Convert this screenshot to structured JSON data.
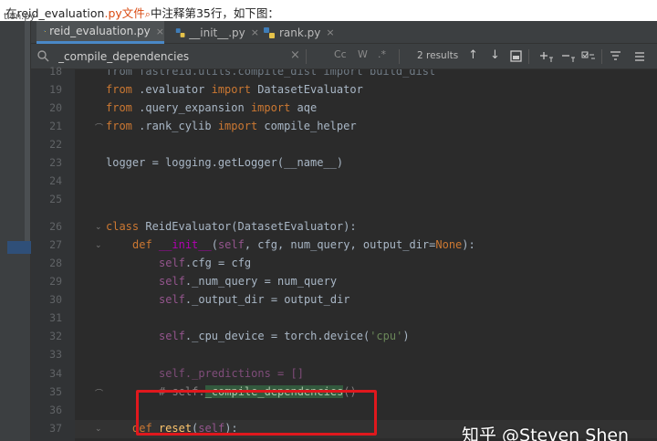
{
  "article": {
    "prefix": "在reid_evaluation",
    "highlight": ".py文件",
    "search_glyph": "⌕",
    "suffix": "中注释第35行，如下图：",
    "clipped": "tion.py"
  },
  "tabs": [
    {
      "label": "reid_evaluation.py",
      "close": "×",
      "active": true
    },
    {
      "label": "__init__.py",
      "close": "×",
      "active": false
    },
    {
      "label": "rank.py",
      "close": "×",
      "active": false
    }
  ],
  "search": {
    "value": "_compile_dependencies",
    "clear": "×",
    "cc": "Cc",
    "w": "W",
    "regex": ".*",
    "results": "2 results",
    "up": "↑",
    "down": "↓"
  },
  "lines": [
    {
      "num": "18"
    },
    {
      "num": "19"
    },
    {
      "num": "20"
    },
    {
      "num": "21"
    },
    {
      "num": "22"
    },
    {
      "num": "23"
    },
    {
      "num": "24"
    },
    {
      "num": "25"
    },
    {
      "num": "26"
    },
    {
      "num": "27"
    },
    {
      "num": "28"
    },
    {
      "num": "29"
    },
    {
      "num": "30"
    },
    {
      "num": "31"
    },
    {
      "num": "32"
    },
    {
      "num": "33"
    },
    {
      "num": "34"
    },
    {
      "num": "35"
    },
    {
      "num": "36"
    },
    {
      "num": "37"
    }
  ],
  "code": {
    "l18": "from fastreid.utils.compile_dist import build_dist",
    "l19_from": "from",
    "l19_mod": " .evaluator ",
    "l19_imp": "import",
    "l19_name": " DatasetEvaluator",
    "l20_from": "from",
    "l20_mod": " .query_expansion ",
    "l20_imp": "import",
    "l20_name": " aqe",
    "l21_from": "from",
    "l21_mod": " .rank_cylib ",
    "l21_imp": "import",
    "l21_name": " compile_helper",
    "l23": "logger = logging.getLogger(__name__)",
    "l26_class": "class",
    "l26_rest": " ReidEvaluator(DatasetEvaluator):",
    "l27_def": "def",
    "l27_init": "__init__",
    "l27_self": "self",
    "l27_args": ", cfg, num_query, output_dir=",
    "l27_none": "None",
    "l27_end": "):",
    "l28_self": "self",
    "l28_rest": ".cfg = cfg",
    "l29_self": "self",
    "l29_rest": "._num_query = num_query",
    "l30_self": "self",
    "l30_rest": "._output_dir = output_dir",
    "l32_self": "self",
    "l32_rest": "._cpu_device = torch.device(",
    "l32_str": "'cpu'",
    "l32_end": ")",
    "l34": "self._predictions = []",
    "l35_pre": "# self.",
    "l35_hit": "_compile_dependencies",
    "l35_end": "()",
    "l37_def": "def",
    "l37_name": "reset",
    "l37_self": "self",
    "l37_end": "):"
  },
  "watermark": "知乎 @Steven Shen",
  "colors": {
    "keyword": "#cc7832",
    "self": "#94558d",
    "string": "#6a8759",
    "comment": "#808080",
    "highlight_box": "#e0181d",
    "match": "#32593d"
  }
}
